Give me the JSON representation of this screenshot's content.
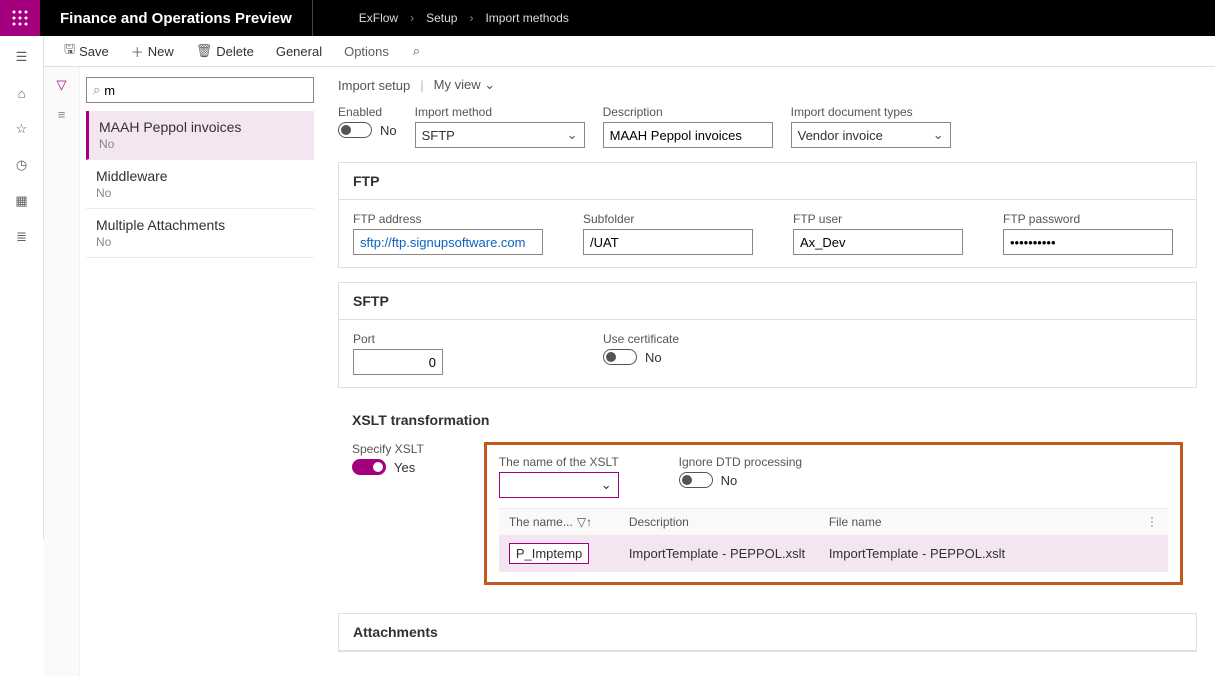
{
  "header": {
    "app_title": "Finance and Operations Preview",
    "breadcrumb": [
      "ExFlow",
      "Setup",
      "Import methods"
    ]
  },
  "commands": {
    "save": "Save",
    "new": "New",
    "delete": "Delete",
    "general": "General",
    "options": "Options"
  },
  "search": {
    "value": "m"
  },
  "list": [
    {
      "title": "MAAH Peppol invoices",
      "sub": "No",
      "selected": true
    },
    {
      "title": "Middleware",
      "sub": "No",
      "selected": false
    },
    {
      "title": "Multiple Attachments",
      "sub": "No",
      "selected": false
    }
  ],
  "view": {
    "page": "Import setup",
    "myview": "My view"
  },
  "form": {
    "enabled": {
      "label": "Enabled",
      "value": "No"
    },
    "import_method": {
      "label": "Import method",
      "value": "SFTP"
    },
    "description": {
      "label": "Description",
      "value": "MAAH Peppol invoices"
    },
    "doc_types": {
      "label": "Import document types",
      "value": "Vendor invoice"
    }
  },
  "ftp": {
    "title": "FTP",
    "address": {
      "label": "FTP address",
      "value": "sftp://ftp.signupsoftware.com"
    },
    "subfolder": {
      "label": "Subfolder",
      "value": "/UAT"
    },
    "user": {
      "label": "FTP user",
      "value": "Ax_Dev"
    },
    "password": {
      "label": "FTP password",
      "value": "••••••••••"
    }
  },
  "sftp": {
    "title": "SFTP",
    "port": {
      "label": "Port",
      "value": "0"
    },
    "cert": {
      "label": "Use certificate",
      "value": "No"
    }
  },
  "xslt": {
    "title": "XSLT transformation",
    "specify": {
      "label": "Specify XSLT",
      "value": "Yes"
    },
    "name_label": "The name of the XSLT",
    "ignore": {
      "label": "Ignore DTD processing",
      "value": "No"
    },
    "grid": {
      "cols": {
        "c1": "The name...",
        "c2": "Description",
        "c3": "File name"
      },
      "row": {
        "c1": "P_Imptemp",
        "c2": "ImportTemplate - PEPPOL.xslt",
        "c3": "ImportTemplate - PEPPOL.xslt"
      }
    }
  },
  "attachments": {
    "title": "Attachments"
  }
}
